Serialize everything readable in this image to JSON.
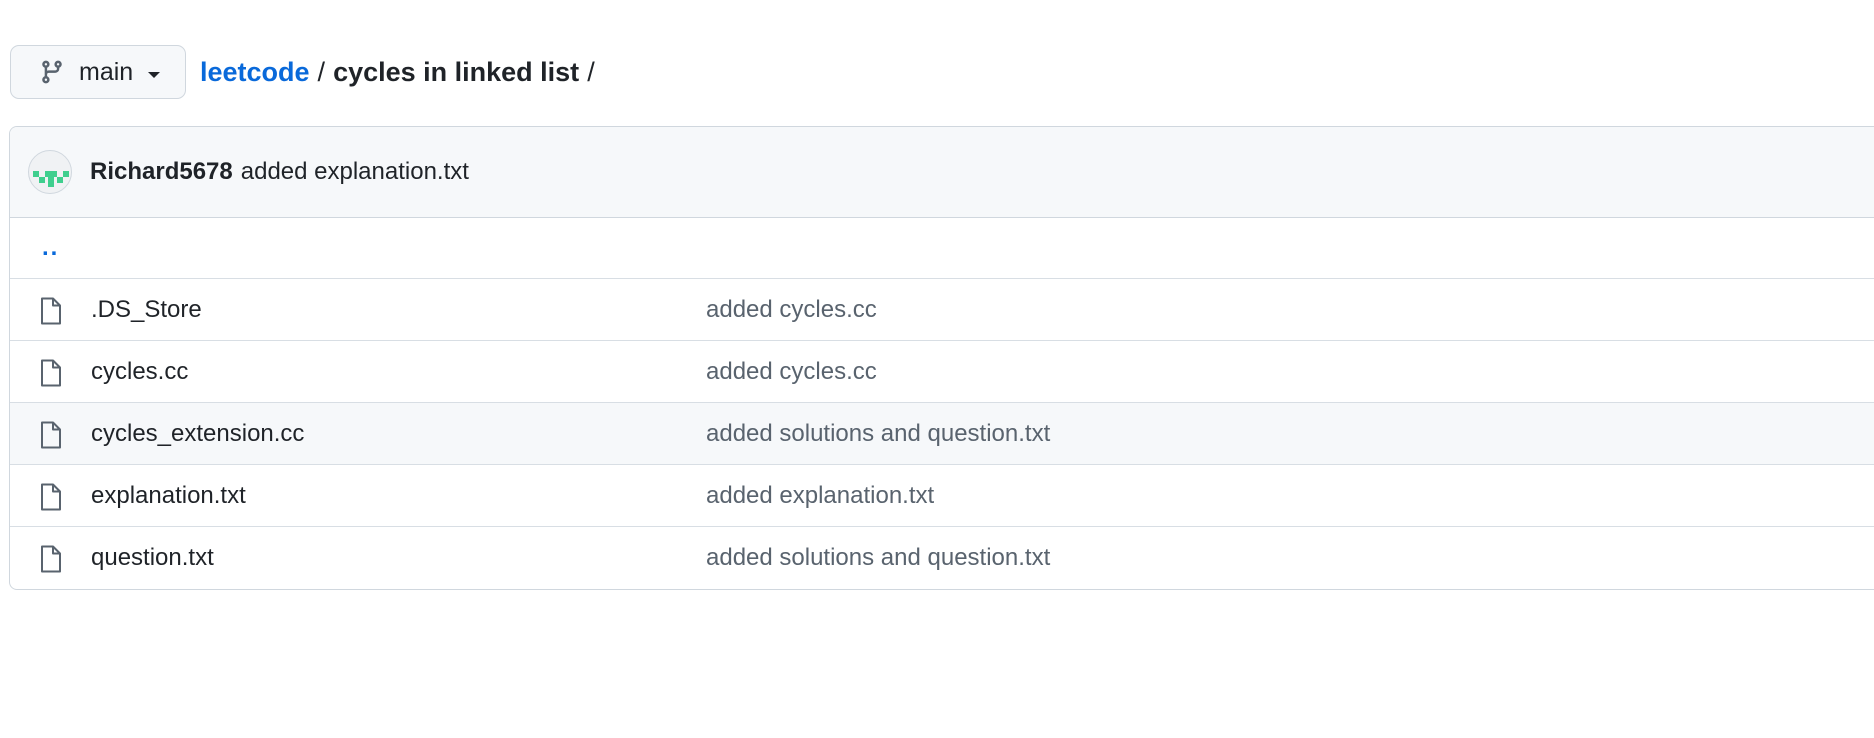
{
  "branch": {
    "name": "main",
    "icon": "git-branch-icon"
  },
  "breadcrumb": {
    "repo": "leetcode",
    "separator": "/",
    "current": "cycles in linked list",
    "trailing": "/"
  },
  "commit": {
    "author": "Richard5678",
    "message": "added explanation.txt"
  },
  "parent_link": "..",
  "files": [
    {
      "name": ".DS_Store",
      "commit": "added cycles.cc"
    },
    {
      "name": "cycles.cc",
      "commit": "added cycles.cc"
    },
    {
      "name": "cycles_extension.cc",
      "commit": "added solutions and question.txt"
    },
    {
      "name": "explanation.txt",
      "commit": "added explanation.txt"
    },
    {
      "name": "question.txt",
      "commit": "added solutions and question.txt"
    }
  ],
  "colors": {
    "link": "#0969da",
    "text": "#1f2328",
    "muted": "#59636e",
    "border": "#d0d7de",
    "header_bg": "#f6f8fa",
    "avatar_green": "#3fcf8e"
  }
}
